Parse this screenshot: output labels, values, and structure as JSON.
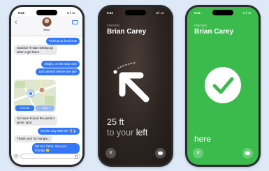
{
  "status": {
    "time": "9:41",
    "signal": "..ll",
    "battery": "▭"
  },
  "messages": {
    "contact_name": "Brian",
    "thread": [
      {
        "dir": "out",
        "text": "Picking up food now"
      },
      {
        "dir": "in",
        "text": "Gotcha! I'll start setting up when I get there."
      },
      {
        "dir": "out",
        "text": "Alright, on the way over"
      },
      {
        "dir": "out",
        "text": "Just parked! Where are ya?"
      },
      {
        "dir": "in",
        "text": "I'm here! Found the perfect picnic spot."
      },
      {
        "dir": "out",
        "text": "On the way with the 🍕🥤"
      },
      {
        "dir": "in",
        "text": "Thank you! So hungry..."
      },
      {
        "dir": "out",
        "text": "Me too, haha. See you shortly! 🙂"
      }
    ],
    "map_buttons": {
      "find": "Find Me",
      "stop": "Stop"
    }
  },
  "finder": {
    "label": "FINDING",
    "person": "Brian Carey",
    "distance": "25 ft",
    "direction_prefix": "to your",
    "direction": "left",
    "arrived_text": "here"
  },
  "colors": {
    "imessage_blue": "#3478f6",
    "arrived_green": "#3bbb4c"
  }
}
